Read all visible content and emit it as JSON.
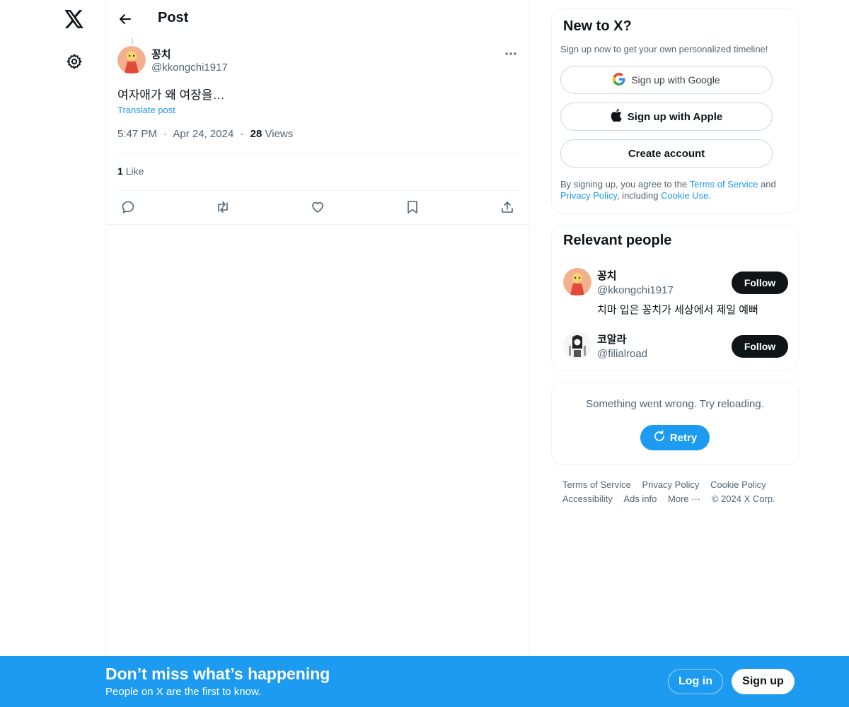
{
  "nav": {
    "logo_icon": "x-logo-icon",
    "settings_icon": "gear-icon"
  },
  "header": {
    "title": "Post",
    "back_icon": "arrow-left-icon"
  },
  "post": {
    "author_name": "꽁치",
    "author_handle": "@kkongchi1917",
    "text": "여자애가 왜 여장을…",
    "translate_label": "Translate post",
    "time": "5:47 PM",
    "date": "Apr 24, 2024",
    "separator": "·",
    "views_count": "28",
    "views_label": "Views",
    "likes_count": "1",
    "likes_label": "Like"
  },
  "signup_card": {
    "title": "New to X?",
    "subtitle": "Sign up now to get your own personalized timeline!",
    "google_label": "Sign up with Google",
    "apple_label": "Sign up with Apple",
    "create_label": "Create account",
    "legal_prefix": "By signing up, you agree to the",
    "terms_link": "Terms of Service",
    "legal_and": "and",
    "privacy_link": "Privacy Policy",
    "legal_including": ", including",
    "cookie_link": "Cookie Use",
    "legal_end": "."
  },
  "relevant": {
    "title": "Relevant people",
    "people": [
      {
        "name": "꽁치",
        "handle": "@kkongchi1917",
        "bio": "치마 입은 꽁치가 세상에서 제일 예뻐",
        "follow_label": "Follow"
      },
      {
        "name": "코알라",
        "handle": "@filialroad",
        "follow_label": "Follow"
      }
    ]
  },
  "error_card": {
    "message": "Something went wrong. Try reloading.",
    "retry_label": "Retry"
  },
  "footer": {
    "links": [
      "Terms of Service",
      "Privacy Policy",
      "Cookie Policy",
      "Accessibility",
      "Ads info",
      "More ···"
    ],
    "copyright": "© 2024 X Corp."
  },
  "bottom_bar": {
    "title": "Don’t miss what’s happening",
    "subtitle": "People on X are the first to know.",
    "login_label": "Log in",
    "signup_label": "Sign up"
  },
  "colors": {
    "accent": "#1d9bf0",
    "text_primary": "#0f1419",
    "text_secondary": "#536471"
  }
}
